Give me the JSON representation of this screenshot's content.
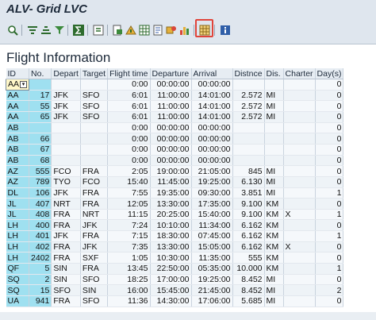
{
  "window": {
    "title": "ALV- Grid LVC"
  },
  "toolbar": {
    "icons": [
      "details-icon",
      "sort-ascending-icon",
      "sort-descending-icon",
      "filter-icon",
      "sum-icon",
      "subtotal-icon",
      "print-preview-icon",
      "export-icon",
      "spreadsheet-icon",
      "word-processing-icon",
      "layout-icon",
      "abc-analysis-icon",
      "graphic-icon",
      "views-grid-icon",
      "info-icon"
    ],
    "highlight_color": "#e0443a"
  },
  "main": {
    "heading": "Flight Information",
    "columns": [
      "ID",
      "No.",
      "Depart",
      "Target",
      "Flight time",
      "Departure",
      "Arrival",
      "Distnce",
      "Dis.",
      "Charter",
      "Day(s)"
    ],
    "rows": [
      [
        "AA",
        "",
        "",
        "",
        "0:00",
        "00:00:00",
        "00:00:00",
        "",
        "",
        "",
        "0"
      ],
      [
        "AA",
        "17",
        "JFK",
        "SFO",
        "6:01",
        "11:00:00",
        "14:01:00",
        "2.572",
        "MI",
        "",
        "0"
      ],
      [
        "AA",
        "55",
        "JFK",
        "SFO",
        "6:01",
        "11:00:00",
        "14:01:00",
        "2.572",
        "MI",
        "",
        "0"
      ],
      [
        "AA",
        "65",
        "JFK",
        "SFO",
        "6:01",
        "11:00:00",
        "14:01:00",
        "2.572",
        "MI",
        "",
        "0"
      ],
      [
        "AB",
        "",
        "",
        "",
        "0:00",
        "00:00:00",
        "00:00:00",
        "",
        "",
        "",
        "0"
      ],
      [
        "AB",
        "66",
        "",
        "",
        "0:00",
        "00:00:00",
        "00:00:00",
        "",
        "",
        "",
        "0"
      ],
      [
        "AB",
        "67",
        "",
        "",
        "0:00",
        "00:00:00",
        "00:00:00",
        "",
        "",
        "",
        "0"
      ],
      [
        "AB",
        "68",
        "",
        "",
        "0:00",
        "00:00:00",
        "00:00:00",
        "",
        "",
        "",
        "0"
      ],
      [
        "AZ",
        "555",
        "FCO",
        "FRA",
        "2:05",
        "19:00:00",
        "21:05:00",
        "845",
        "MI",
        "",
        "0"
      ],
      [
        "AZ",
        "789",
        "TYO",
        "FCO",
        "15:40",
        "11:45:00",
        "19:25:00",
        "6.130",
        "MI",
        "",
        "0"
      ],
      [
        "DL",
        "106",
        "JFK",
        "FRA",
        "7:55",
        "19:35:00",
        "09:30:00",
        "3.851",
        "MI",
        "",
        "1"
      ],
      [
        "JL",
        "407",
        "NRT",
        "FRA",
        "12:05",
        "13:30:00",
        "17:35:00",
        "9.100",
        "KM",
        "",
        "0"
      ],
      [
        "JL",
        "408",
        "FRA",
        "NRT",
        "11:15",
        "20:25:00",
        "15:40:00",
        "9.100",
        "KM",
        "X",
        "1"
      ],
      [
        "LH",
        "400",
        "FRA",
        "JFK",
        "7:24",
        "10:10:00",
        "11:34:00",
        "6.162",
        "KM",
        "",
        "0"
      ],
      [
        "LH",
        "401",
        "JFK",
        "FRA",
        "7:15",
        "18:30:00",
        "07:45:00",
        "6.162",
        "KM",
        "",
        "1"
      ],
      [
        "LH",
        "402",
        "FRA",
        "JFK",
        "7:35",
        "13:30:00",
        "15:05:00",
        "6.162",
        "KM",
        "X",
        "0"
      ],
      [
        "LH",
        "2402",
        "FRA",
        "SXF",
        "1:05",
        "10:30:00",
        "11:35:00",
        "555",
        "KM",
        "",
        "0"
      ],
      [
        "QF",
        "5",
        "SIN",
        "FRA",
        "13:45",
        "22:50:00",
        "05:35:00",
        "10.000",
        "KM",
        "",
        "1"
      ],
      [
        "SQ",
        "2",
        "SIN",
        "SFO",
        "18:25",
        "17:00:00",
        "19:25:00",
        "8.452",
        "MI",
        "",
        "0"
      ],
      [
        "SQ",
        "15",
        "SFO",
        "SIN",
        "16:00",
        "15:45:00",
        "21:45:00",
        "8.452",
        "MI",
        "",
        "2"
      ],
      [
        "UA",
        "941",
        "FRA",
        "SFO",
        "11:36",
        "14:30:00",
        "17:06:00",
        "5.685",
        "MI",
        "",
        "0"
      ]
    ]
  }
}
